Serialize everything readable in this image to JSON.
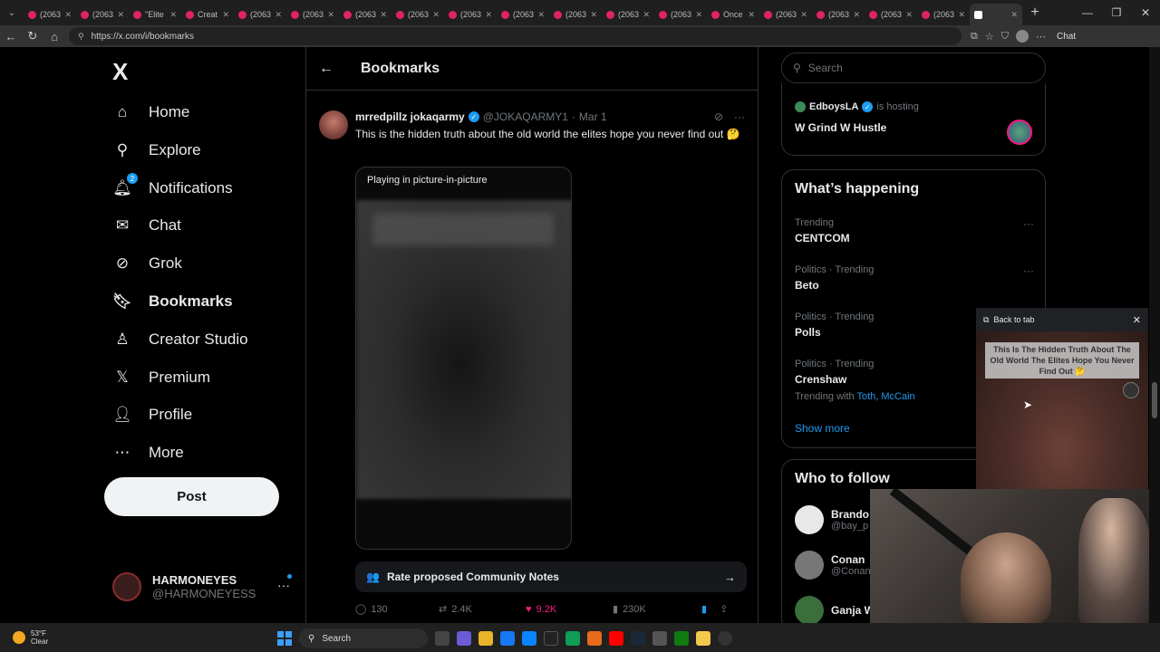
{
  "browser": {
    "tabs": [
      {
        "label": "(2063",
        "icon": "youtube-icon"
      },
      {
        "label": "(2063",
        "icon": "youtube-icon"
      },
      {
        "label": "\"Elite",
        "icon": "youtube-icon"
      },
      {
        "label": "Creat",
        "icon": "youtube-icon"
      },
      {
        "label": "(2063",
        "icon": "youtube-icon"
      },
      {
        "label": "(2063",
        "icon": "youtube-icon"
      },
      {
        "label": "(2063",
        "icon": "youtube-icon"
      },
      {
        "label": "(2063",
        "icon": "youtube-icon"
      },
      {
        "label": "(2063",
        "icon": "youtube-icon"
      },
      {
        "label": "(2063",
        "icon": "youtube-icon"
      },
      {
        "label": "(2063",
        "icon": "youtube-icon"
      },
      {
        "label": "(2063",
        "icon": "youtube-icon"
      },
      {
        "label": "(2063",
        "icon": "youtube-icon"
      },
      {
        "label": "Once",
        "icon": "youtube-icon"
      },
      {
        "label": "(2063",
        "icon": "youtube-icon"
      },
      {
        "label": "(2063",
        "icon": "youtube-icon"
      },
      {
        "label": "(2063",
        "icon": "youtube-icon"
      },
      {
        "label": "(2063",
        "icon": "youtube-icon"
      },
      {
        "label": "",
        "icon": "x-icon",
        "active": true
      }
    ],
    "url": "https://x.com/i/bookmarks",
    "chat_label": "Chat"
  },
  "nav": {
    "logo": "X",
    "items": [
      {
        "label": "Home",
        "icon": "home-icon"
      },
      {
        "label": "Explore",
        "icon": "search-icon"
      },
      {
        "label": "Notifications",
        "icon": "bell-icon",
        "badge": "2"
      },
      {
        "label": "Chat",
        "icon": "mail-icon"
      },
      {
        "label": "Grok",
        "icon": "grok-icon"
      },
      {
        "label": "Bookmarks",
        "icon": "bookmark-icon",
        "active": true
      },
      {
        "label": "Creator Studio",
        "icon": "creator-studio-icon"
      },
      {
        "label": "Premium",
        "icon": "x-premium-icon"
      },
      {
        "label": "Profile",
        "icon": "person-icon"
      },
      {
        "label": "More",
        "icon": "more-circle-icon"
      }
    ],
    "post_label": "Post",
    "account": {
      "name": "HARMONEYES",
      "handle": "@HARMONEYESS"
    }
  },
  "main": {
    "title": "Bookmarks",
    "tweet": {
      "author": "mrredpillz jokaqarmy",
      "handle": "@JOKAQARMY1",
      "separator": "·",
      "date": "Mar 1",
      "text": "This is the hidden truth about the old world the elites hope you never find out 🤔",
      "media_label": "Playing in picture-in-picture",
      "community_notes": "Rate proposed Community Notes",
      "stats": {
        "replies": "130",
        "reposts": "2.4K",
        "likes": "9.2K",
        "views": "230K"
      }
    }
  },
  "right": {
    "search_placeholder": "Search",
    "space": {
      "host": "EdboysLA",
      "hosting_text": "is hosting",
      "title": "W Grind W Hustle"
    },
    "happening": {
      "title": "What’s happening",
      "trends": [
        {
          "category": "Trending",
          "name": "CENTCOM"
        },
        {
          "category": "Politics · Trending",
          "name": "Beto"
        },
        {
          "category": "Politics · Trending",
          "name": "Polls"
        },
        {
          "category": "Politics · Trending",
          "name": "Crenshaw",
          "with_label": "Trending with",
          "with_names": "Toth, McCain"
        }
      ],
      "show_more": "Show more"
    },
    "who_to_follow": {
      "title": "Who to follow",
      "accounts": [
        {
          "name": "Brando",
          "handle": "@bay_p"
        },
        {
          "name": "Conan",
          "handle": "@Conan"
        },
        {
          "name": "Ganja W",
          "handle": ""
        }
      ]
    }
  },
  "pip": {
    "back_label": "Back to tab",
    "caption": "This Is The Hidden Truth About The Old World The Elites Hope You Never Find Out 🤔"
  },
  "taskbar": {
    "weather_temp": "53°F",
    "weather_desc": "Clear",
    "search_label": "Search"
  }
}
